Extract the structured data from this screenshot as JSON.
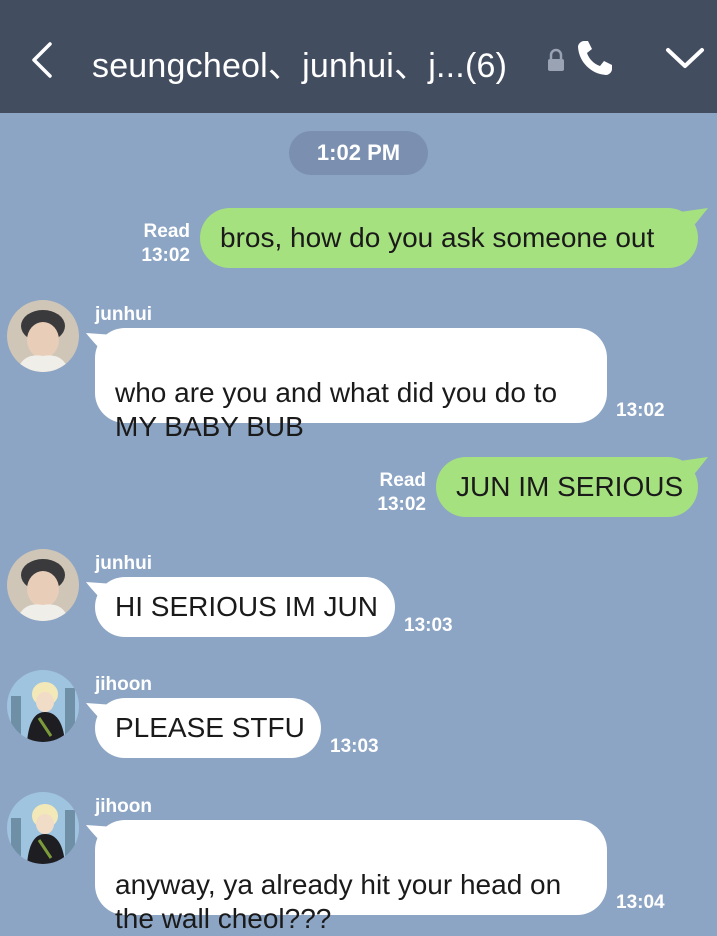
{
  "header": {
    "title": "seungcheol、junhui、j...(6)",
    "icons": [
      "back-chevron-icon",
      "lock-icon",
      "phone-icon",
      "chevron-down-icon"
    ]
  },
  "chat": {
    "date_pill": "1:02 PM",
    "messages": [
      {
        "side": "out",
        "text": "bros, how do you ask someone out",
        "read": "Read",
        "time": "13:02"
      },
      {
        "side": "in",
        "sender": "junhui",
        "text": "who are you and what did you do to\nMY BABY BUB",
        "time": "13:02"
      },
      {
        "side": "out",
        "text": "JUN IM SERIOUS",
        "read": "Read",
        "time": "13:02"
      },
      {
        "side": "in",
        "sender": "junhui",
        "text": "HI SERIOUS IM JUN",
        "time": "13:03"
      },
      {
        "side": "in",
        "sender": "jihoon",
        "text": "PLEASE STFU",
        "time": "13:03"
      },
      {
        "side": "in",
        "sender": "jihoon",
        "text": "anyway, ya already hit your head on\nthe wall cheol???",
        "time": "13:04"
      }
    ]
  },
  "colors": {
    "header_bg": "#434d60",
    "chat_bg": "#8da5c4",
    "outgoing_bubble": "#a6e17f",
    "incoming_bubble": "#ffffff"
  }
}
